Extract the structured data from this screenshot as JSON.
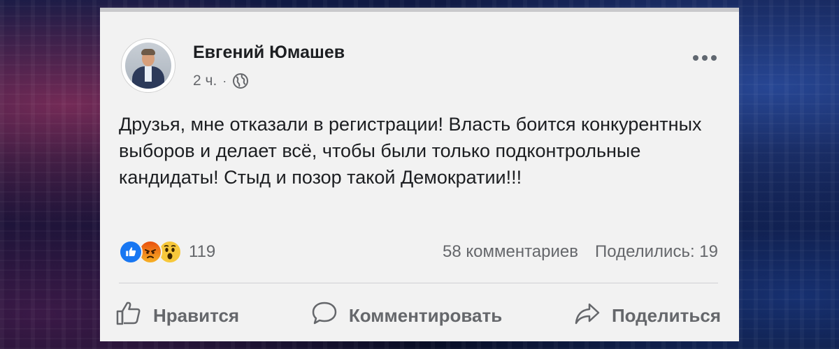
{
  "post": {
    "author": "Евгений Юмашев",
    "time": "2 ч.",
    "separator": "·",
    "privacy_icon": "globe-icon",
    "text": "Друзья, мне отказали в регистрации! Власть боится конкурентных выборов и делает всё, чтобы были только подконтрольные кандидаты! Стыд и позор такой Демократии!!!",
    "reactions": {
      "icons": [
        "like-icon",
        "angry-icon",
        "wow-icon"
      ],
      "count": "119"
    },
    "comments": "58 комментариев",
    "shares": "Поделились: 19"
  },
  "actions": {
    "like": "Нравится",
    "comment": "Комментировать",
    "share": "Поделиться"
  },
  "colors": {
    "card_background": "#f2f2f2",
    "text_primary": "#1c1e21",
    "text_secondary": "#65676b",
    "like_blue": "#1877f2"
  }
}
